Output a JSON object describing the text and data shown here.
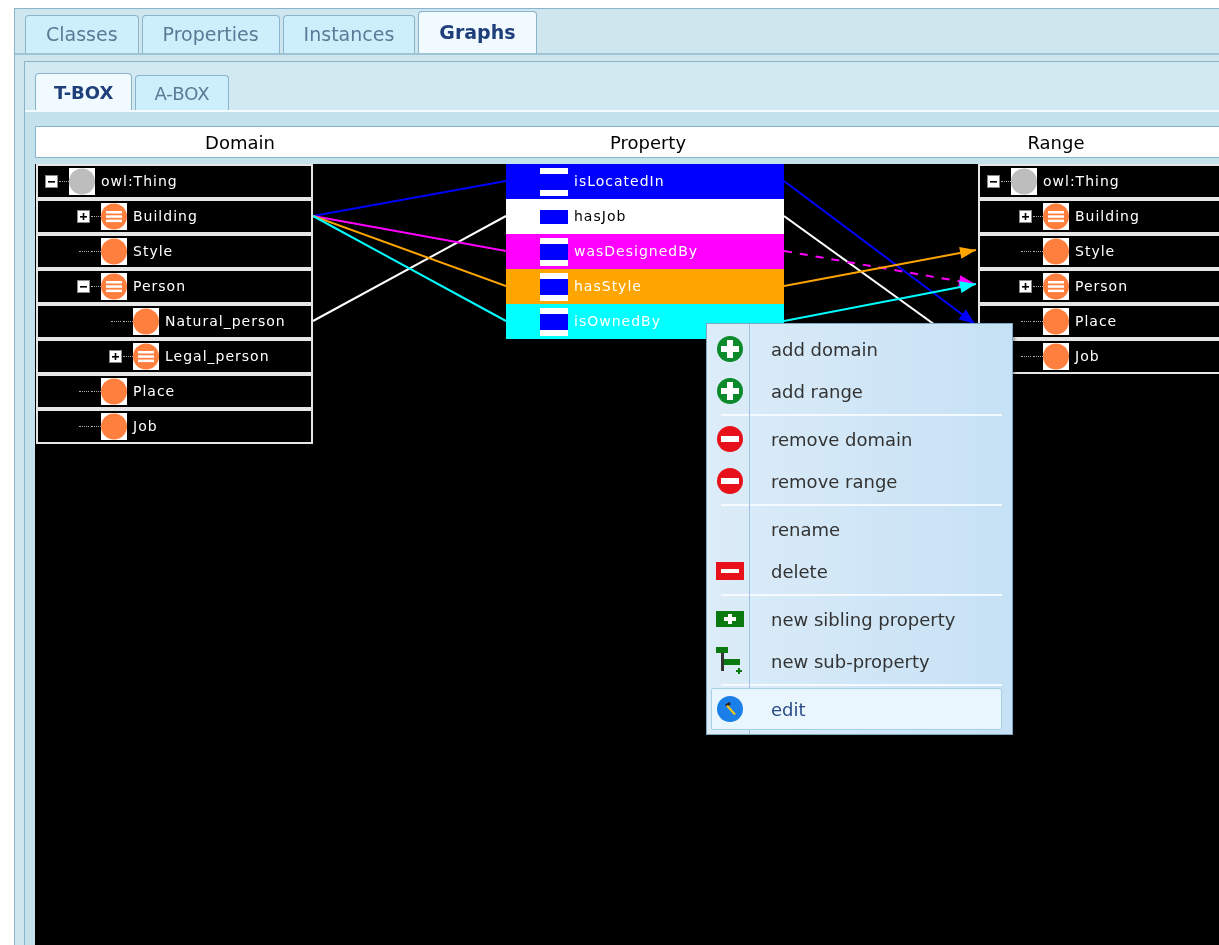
{
  "tabs": [
    {
      "label": "Classes",
      "selected": false
    },
    {
      "label": "Properties",
      "selected": false
    },
    {
      "label": "Instances",
      "selected": false
    },
    {
      "label": "Graphs",
      "selected": true
    }
  ],
  "subtabs": [
    {
      "label": "T-BOX",
      "selected": true
    },
    {
      "label": "A-BOX",
      "selected": false
    }
  ],
  "domain": {
    "header": "Domain",
    "tree": [
      {
        "label": "owl:Thing",
        "kind": "root",
        "expanded": true,
        "children": [
          {
            "label": "Building",
            "expanded": false
          },
          {
            "label": "Style"
          },
          {
            "label": "Person",
            "expanded": true,
            "children": [
              {
                "label": "Natural_person"
              },
              {
                "label": "Legal_person",
                "expanded": false
              }
            ]
          },
          {
            "label": "Place"
          },
          {
            "label": "Job"
          }
        ]
      }
    ]
  },
  "property": {
    "header": "Property",
    "items": [
      {
        "label": "isLocatedIn",
        "color": "#0000ff",
        "kind": "parent"
      },
      {
        "label": "hasJob",
        "color": "#ffffff",
        "kind": "leaf"
      },
      {
        "label": "wasDesignedBy",
        "color": "#ff00ff",
        "kind": "parent"
      },
      {
        "label": "hasStyle",
        "color": "#ffa500",
        "kind": "parent"
      },
      {
        "label": "isOwnedBy",
        "color": "#00ffff",
        "kind": "parent"
      }
    ]
  },
  "range": {
    "header": "Range",
    "tree": [
      {
        "label": "owl:Thing",
        "kind": "root",
        "expanded": true,
        "children": [
          {
            "label": "Building",
            "expanded": false
          },
          {
            "label": "Style"
          },
          {
            "label": "Person",
            "expanded": false
          },
          {
            "label": "Place"
          },
          {
            "label": "Job"
          }
        ]
      }
    ]
  },
  "context_menu": {
    "groups": [
      {
        "items": [
          {
            "label": "add domain",
            "kind": "add",
            "selected": false
          },
          {
            "label": "add range",
            "kind": "add",
            "selected": false
          }
        ]
      },
      {
        "items": [
          {
            "label": "remove domain",
            "kind": "remove",
            "selected": false
          },
          {
            "label": "remove range",
            "kind": "remove",
            "selected": false
          }
        ]
      },
      {
        "items": [
          {
            "label": "rename",
            "kind": "plain",
            "selected": false
          },
          {
            "label": "delete",
            "kind": "delete",
            "selected": false
          }
        ]
      },
      {
        "items": [
          {
            "label": "new sibling property",
            "kind": "sibling",
            "selected": false
          },
          {
            "label": "new sub-property",
            "kind": "subproperty",
            "selected": false
          }
        ]
      },
      {
        "items": [
          {
            "label": "edit",
            "kind": "edit",
            "selected": true
          }
        ]
      }
    ]
  }
}
